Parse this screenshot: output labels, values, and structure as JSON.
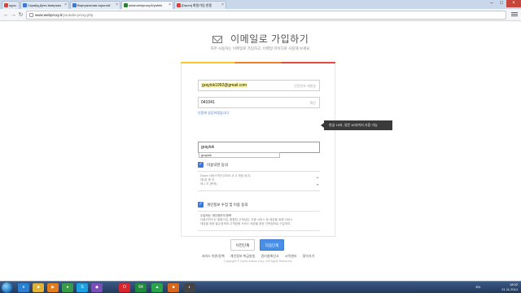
{
  "browser": {
    "tabs": [
      {
        "label": "ogou",
        "active": false,
        "color": "#d9433a"
      },
      {
        "label": "Скрайд Дети Америки",
        "active": false,
        "color": "#3b78d8"
      },
      {
        "label": "Виртуальная скрытой",
        "active": false,
        "color": "#3b78d8"
      },
      {
        "label": "www.webproxy.lt/yahrki",
        "active": true,
        "color": "#2e7d32"
      },
      {
        "label": "[Daum] 화원가입 한종",
        "active": false,
        "color": "#d9433a"
      }
    ],
    "url_host": "www.webproxy.lt",
    "url_path": "/youtube-proxy.php"
  },
  "signup": {
    "title": "이메일로 가입하기",
    "subtitle": "자주 사용하는 이메일로 가입하고, 이메일 아이디로 사용해 보세요.",
    "email_value": "graylok1992@gmail.com",
    "email_hint": "인증번호 재발송",
    "code_value": "041041",
    "code_hint": "확인",
    "code_link": "인증에 성공하였습니다.",
    "nickname_value": "graylok",
    "autocomplete_value": "graylok",
    "tooltip": "한글 15자, 영문 30자까지 사용 가능",
    "terms1_label": "이용약관 동의",
    "terms1_text": [
      "Daum 서비스약관 (2009. 8. 6 개정 공고)",
      "제1장 총 칙",
      "제 1 조 (목적)"
    ],
    "terms2_label": "개인정보 수집 및 이용 동의",
    "terms2_heading": "수집하는 개인정보의 항목",
    "terms2_text": [
      "다음카카오는 회원가입, 원활한 고객상담, 각종 서비스 등 제공을 위해 서비스",
      "제공을 위한 필수정보와 고객맞춤 서비스 제공을 위한 선택정보로 구분하여"
    ],
    "prev_button": "이전단계",
    "next_button": "다음단계"
  },
  "footer": {
    "links": [
      "서비스 약관/정책",
      "개인정보 취급방침",
      "권리침해신고",
      "고객센터",
      "찾아가기"
    ],
    "copyright": "Copyright © Daum Kakao Corp. All Rights Reserved."
  },
  "taskbar": {
    "apps": [
      {
        "name": "ie-icon",
        "color": "#2b7fd1",
        "glyph": "e"
      },
      {
        "name": "folder-icon",
        "color": "#e0b23a",
        "glyph": "■"
      },
      {
        "name": "media-icon",
        "color": "#e27d1f",
        "glyph": "▶"
      },
      {
        "name": "chrome-icon",
        "color": "#3a9b46",
        "glyph": "●"
      },
      {
        "name": "skype-icon",
        "color": "#1ba1e2",
        "glyph": "S"
      },
      {
        "name": "vs-icon",
        "color": "#7a4fb7",
        "glyph": "◆"
      },
      {
        "name": "opera-icon",
        "color": "#d7262d",
        "glyph": "O"
      },
      {
        "name": "app-64-icon",
        "color": "#1f8a3d",
        "glyph": "64"
      },
      {
        "name": "app-green-icon",
        "color": "#2aa34a",
        "glyph": "▲"
      },
      {
        "name": "app-orange-icon",
        "color": "#d8661b",
        "glyph": "■"
      },
      {
        "name": "app-dark-icon",
        "color": "#444",
        "glyph": "◐"
      }
    ],
    "lang": "EN",
    "time": "18:02",
    "date": "21.11.2014"
  }
}
